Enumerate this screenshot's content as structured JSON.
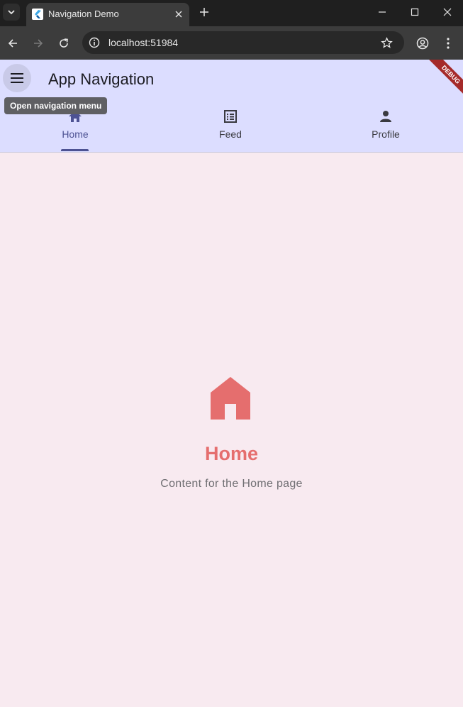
{
  "browser": {
    "tab_title": "Navigation Demo",
    "url": "localhost:51984",
    "icons": {
      "tab_menu": "chevron-down-icon",
      "close_tab": "close-icon",
      "new_tab": "plus-icon",
      "minimize": "minimize-icon",
      "maximize": "maximize-icon",
      "close_window": "close-icon",
      "back": "arrow-left-icon",
      "forward": "arrow-right-icon",
      "reload": "reload-icon",
      "site_info": "info-icon",
      "bookmark": "star-icon",
      "profile": "account-icon",
      "menu": "kebab-menu-icon"
    }
  },
  "app": {
    "title": "App Navigation",
    "menu_tooltip": "Open navigation menu",
    "debug_banner": "DEBUG",
    "tabs": [
      {
        "label": "Home",
        "icon": "home-icon",
        "selected": true
      },
      {
        "label": "Feed",
        "icon": "list-icon",
        "selected": false
      },
      {
        "label": "Profile",
        "icon": "person-icon",
        "selected": false
      }
    ],
    "content": {
      "icon": "home-icon",
      "title": "Home",
      "subtitle": "Content for the Home page"
    },
    "colors": {
      "appbar_bg": "#dcddff",
      "page_bg": "#f8eaf0",
      "selected_tab": "#4d5293",
      "accent": "#e56e6e",
      "debug_banner": "#a52a2a"
    }
  }
}
